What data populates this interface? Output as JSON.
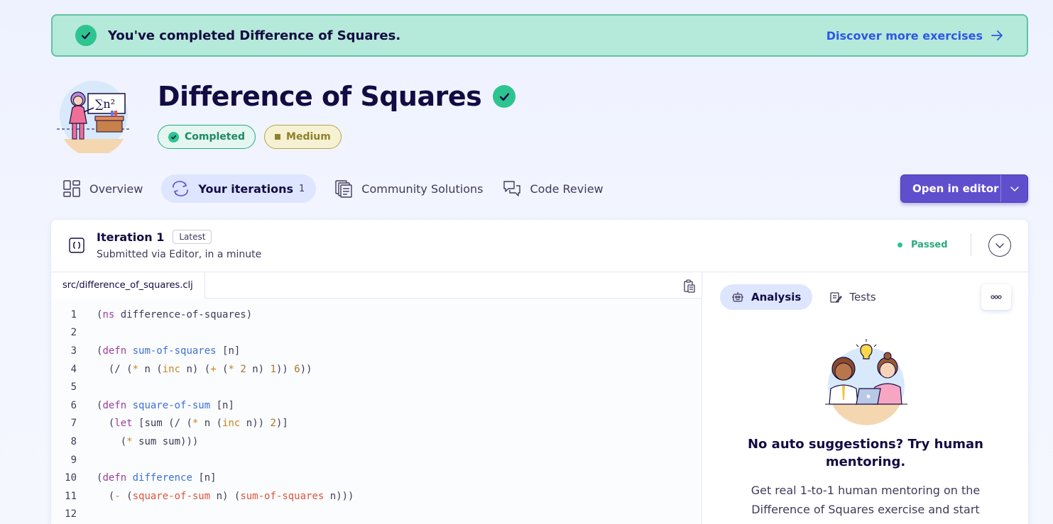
{
  "banner": {
    "message": "You've completed Difference of Squares.",
    "link_label": "Discover more exercises"
  },
  "exercise": {
    "title": "Difference of Squares",
    "tags": {
      "completed": "Completed",
      "difficulty": "Medium"
    }
  },
  "tabs": [
    {
      "label": "Overview"
    },
    {
      "label": "Your iterations",
      "count": "1"
    },
    {
      "label": "Community Solutions"
    },
    {
      "label": "Code Review"
    }
  ],
  "open_editor_label": "Open in editor",
  "iteration": {
    "title": "Iteration 1",
    "badge": "Latest",
    "subtitle": "Submitted via Editor, in a minute",
    "status": "Passed"
  },
  "file": {
    "name": "src/difference_of_squares.clj"
  },
  "code_lines": [
    {
      "n": "1"
    },
    {
      "n": "2"
    },
    {
      "n": "3"
    },
    {
      "n": "4"
    },
    {
      "n": "5"
    },
    {
      "n": "6"
    },
    {
      "n": "7"
    },
    {
      "n": "8"
    },
    {
      "n": "9"
    },
    {
      "n": "10"
    },
    {
      "n": "11"
    },
    {
      "n": "12"
    }
  ],
  "code_tokens": {
    "l1": [
      "(",
      "ns",
      " difference-of-squares)"
    ],
    "l3": [
      "(",
      "defn",
      " ",
      "sum-of-squares",
      " [n]"
    ],
    "l4": [
      "  (/ (",
      "*",
      " n (",
      "inc",
      " n) (",
      "+",
      " (",
      "*",
      " ",
      "2",
      " n) ",
      "1",
      ")) ",
      "6",
      "))"
    ],
    "l6": [
      "(",
      "defn",
      " ",
      "square-of-sum",
      " [n]"
    ],
    "l7": [
      "  (",
      "let",
      " [sum (/ (",
      "*",
      " n (",
      "inc",
      " n)) ",
      "2",
      ")]"
    ],
    "l8": [
      "    (",
      "*",
      " sum sum)))"
    ],
    "l10": [
      "(",
      "defn",
      " ",
      "difference",
      " [n]"
    ],
    "l11": [
      "  (",
      "-",
      " (",
      "square-of-sum",
      " n) (",
      "sum-of-squares",
      " n)))"
    ]
  },
  "right_panel": {
    "tabs": [
      {
        "label": "Analysis"
      },
      {
        "label": "Tests"
      }
    ],
    "mentor_title": "No auto suggestions? Try human mentoring.",
    "mentor_text": "Get real 1-to-1 human mentoring on the Difference of Squares exercise and start"
  },
  "colors": {
    "accent": "#604fcd",
    "success": "#2ec48f",
    "link": "#2e57e8",
    "banner_bg": "#b5e9d9"
  }
}
